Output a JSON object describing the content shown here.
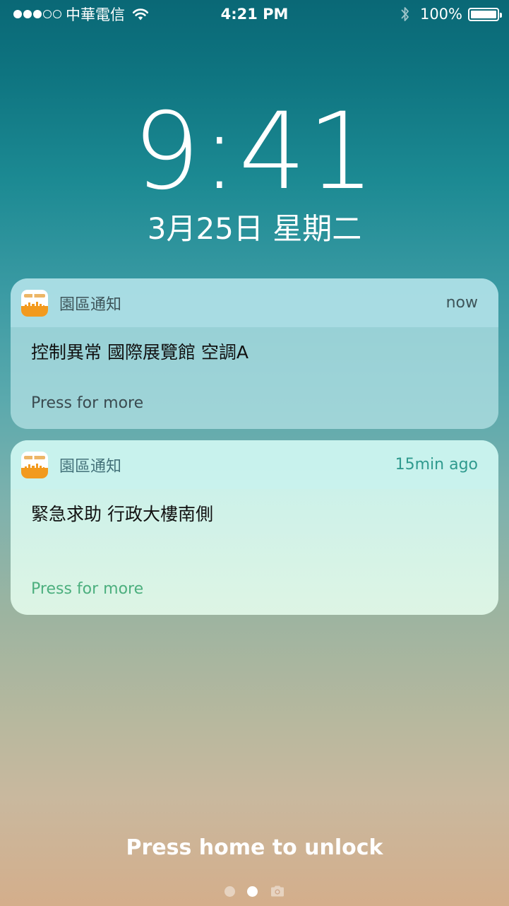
{
  "status_bar": {
    "carrier": "中華電信",
    "time": "4:21 PM",
    "battery_percent": "100%",
    "signal_bars_filled": 3,
    "signal_bars_total": 5
  },
  "lockscreen": {
    "clock": "9:41",
    "date": "3月25日 星期二"
  },
  "notifications": [
    {
      "app_name": "園區通知",
      "time": "now",
      "message": "控制異常 國際展覽館 空調A",
      "more_label": "Press for more"
    },
    {
      "app_name": "園區通知",
      "time": "15min ago",
      "message": "緊急求助  行政大樓南側",
      "more_label": "Press for more"
    }
  ],
  "bottom": {
    "unlock_label": "Press home to unlock",
    "pages_total": 2,
    "page_active": 2
  },
  "colors": {
    "accent_orange": "#f29a1e",
    "notif2_more": "#4caf7e",
    "notif2_time": "#2f9a8e"
  }
}
